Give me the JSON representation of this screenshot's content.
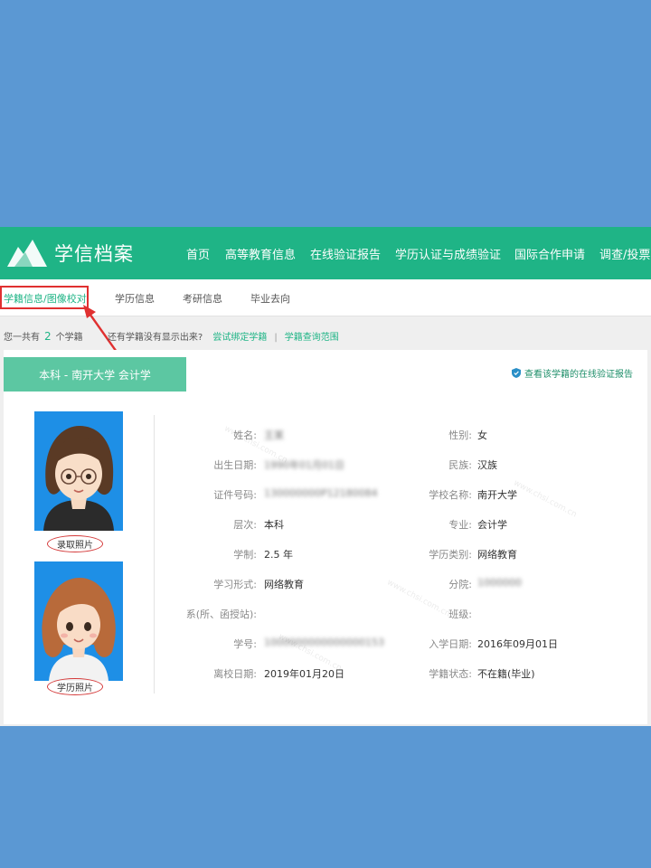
{
  "header": {
    "brand": "学信档案",
    "nav": [
      "首页",
      "高等教育信息",
      "在线验证报告",
      "学历认证与成绩验证",
      "国际合作申请",
      "调查/投票"
    ]
  },
  "subnav": {
    "tabs": [
      "学籍信息/图像校对",
      "学历信息",
      "考研信息",
      "毕业去向"
    ]
  },
  "info": {
    "prefix": "您一共有",
    "count": "2",
    "suffix": "个学籍",
    "question": "还有学籍没有显示出来?",
    "bind_link": "尝试绑定学籍",
    "sep": "|",
    "scope_link": "学籍查询范围"
  },
  "record": {
    "tab_title": "本科 - 南开大学 会计学",
    "verify_link": "查看该学籍的在线验证报告",
    "photo1_caption": "录取照片",
    "photo2_caption": "学历照片",
    "left_fields": [
      {
        "label": "姓名:",
        "value": "王某"
      },
      {
        "label": "出生日期:",
        "value": "1990年01月01日"
      },
      {
        "label": "证件号码:",
        "value": "130000000P12180084"
      },
      {
        "label": "层次:",
        "value": "本科"
      },
      {
        "label": "学制:",
        "value": "2.5 年"
      },
      {
        "label": "学习形式:",
        "value": "网络教育"
      },
      {
        "label": "系(所、函授站):",
        "value": ""
      },
      {
        "label": "学号:",
        "value": "1000000000000000153"
      },
      {
        "label": "离校日期:",
        "value": "2019年01月20日"
      }
    ],
    "right_fields": [
      {
        "label": "性别:",
        "value": "女"
      },
      {
        "label": "民族:",
        "value": "汉族"
      },
      {
        "label": "学校名称:",
        "value": "南开大学"
      },
      {
        "label": "专业:",
        "value": "会计学"
      },
      {
        "label": "学历类别:",
        "value": "网络教育"
      },
      {
        "label": "分院:",
        "value": "1000000"
      },
      {
        "label": "班级:",
        "value": ""
      },
      {
        "label": "入学日期:",
        "value": "2016年09月01日"
      },
      {
        "label": "学籍状态:",
        "value": "不在籍(毕业)"
      }
    ]
  },
  "colors": {
    "primary": "#1fb486",
    "tab": "#5cc7a2",
    "highlight": "#e03030",
    "background": "#5b98d3"
  }
}
